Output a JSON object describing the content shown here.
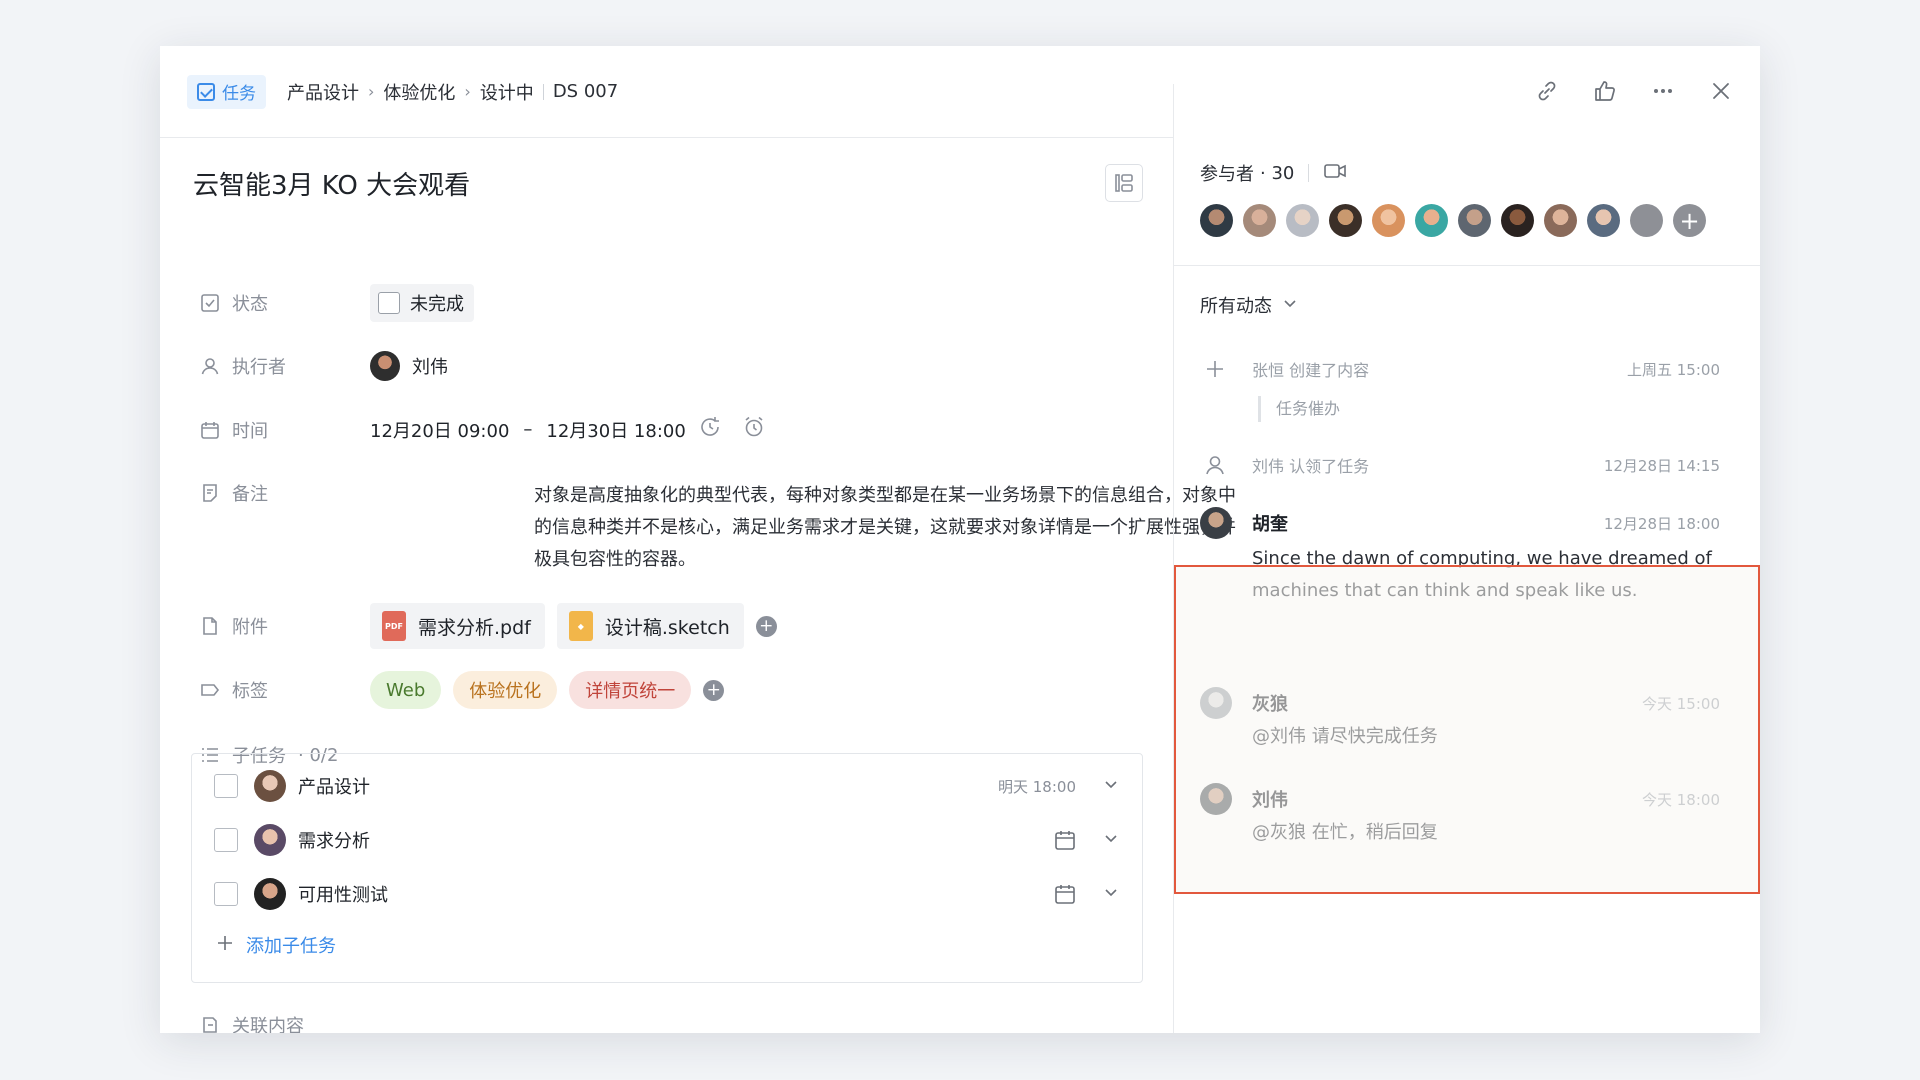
{
  "header": {
    "type_label": "任务",
    "breadcrumb": [
      "产品设计",
      "体验优化",
      "设计中"
    ],
    "task_id": "DS 007"
  },
  "task": {
    "title": "云智能3月 KO 大会观看",
    "fields": {
      "status_label": "状态",
      "status_value": "未完成",
      "assignee_label": "执行者",
      "assignee_name": "刘伟",
      "time_label": "时间",
      "time_start": "12月20日 09:00",
      "time_sep": "–",
      "time_end": "12月30日 18:00",
      "notes_label": "备注",
      "notes_value": "对象是高度抽象化的典型代表，每种对象类型都是在某一业务场景下的信息组合，对象中的信息种类并不是核心，满足业务需求才是关键，这就要求对象详情是一个扩展性强，并极具包容性的容器。",
      "attachments_label": "附件",
      "attachments": [
        {
          "name": "需求分析.pdf",
          "icon": "pdf-file-icon",
          "color": "#e06a5a"
        },
        {
          "name": "设计稿.sketch",
          "icon": "sketch-file-icon",
          "color": "#f2b64a"
        }
      ],
      "tags_label": "标签",
      "tags": [
        {
          "label": "Web",
          "bg": "#e6f4dc",
          "fg": "#4a7a2e"
        },
        {
          "label": "体验优化",
          "bg": "#fbeedd",
          "fg": "#b9721e"
        },
        {
          "label": "详情页统一",
          "bg": "#f8e1df",
          "fg": "#c0443a"
        }
      ]
    },
    "subtasks": {
      "label": "子任务",
      "count": "· 0/2",
      "items": [
        {
          "name": "产品设计",
          "due": "明天 18:00",
          "avatar_color": "#c9a48e"
        },
        {
          "name": "需求分析",
          "due": "",
          "avatar_color": "#7a6a88"
        },
        {
          "name": "可用性测试",
          "due": "",
          "avatar_color": "#3a3a3a"
        }
      ],
      "add_label": "添加子任务"
    },
    "related_label": "关联内容"
  },
  "sidebar": {
    "participants_label": "参与者",
    "participants_count": "· 30",
    "participant_colors": [
      "#2f3a44",
      "#a58a7a",
      "#b8bcc4",
      "#3b2f28",
      "#d9925e",
      "#3aa7a3",
      "#5e6670",
      "#4a3a30",
      "#8a6a5a",
      "#5a6b80",
      "#8e9096"
    ],
    "activity_filter": "所有动态",
    "activities": [
      {
        "kind": "system",
        "icon": "plus-icon",
        "text": "张恒 创建了内容",
        "time": "上周五 15:00",
        "quote": "任务催办"
      },
      {
        "kind": "system",
        "icon": "user-icon",
        "text": "刘伟 认领了任务",
        "time": "12月28日 14:15"
      },
      {
        "kind": "comment",
        "name": "胡奎",
        "time": "12月28日 18:00",
        "body": "Since the dawn of computing, we have dreamed of machines that can think and speak like us.",
        "avatar_color": "#3a3f45"
      },
      {
        "kind": "comment",
        "name": "灰狼",
        "time": "今天 15:00",
        "body": "@刘伟 请尽快完成任务",
        "avatar_color": "#9aa0a6"
      },
      {
        "kind": "comment",
        "name": "刘伟",
        "time": "今天 18:00",
        "body": "@灰狼 在忙，稍后回复",
        "avatar_color": "#4a5056"
      }
    ]
  }
}
